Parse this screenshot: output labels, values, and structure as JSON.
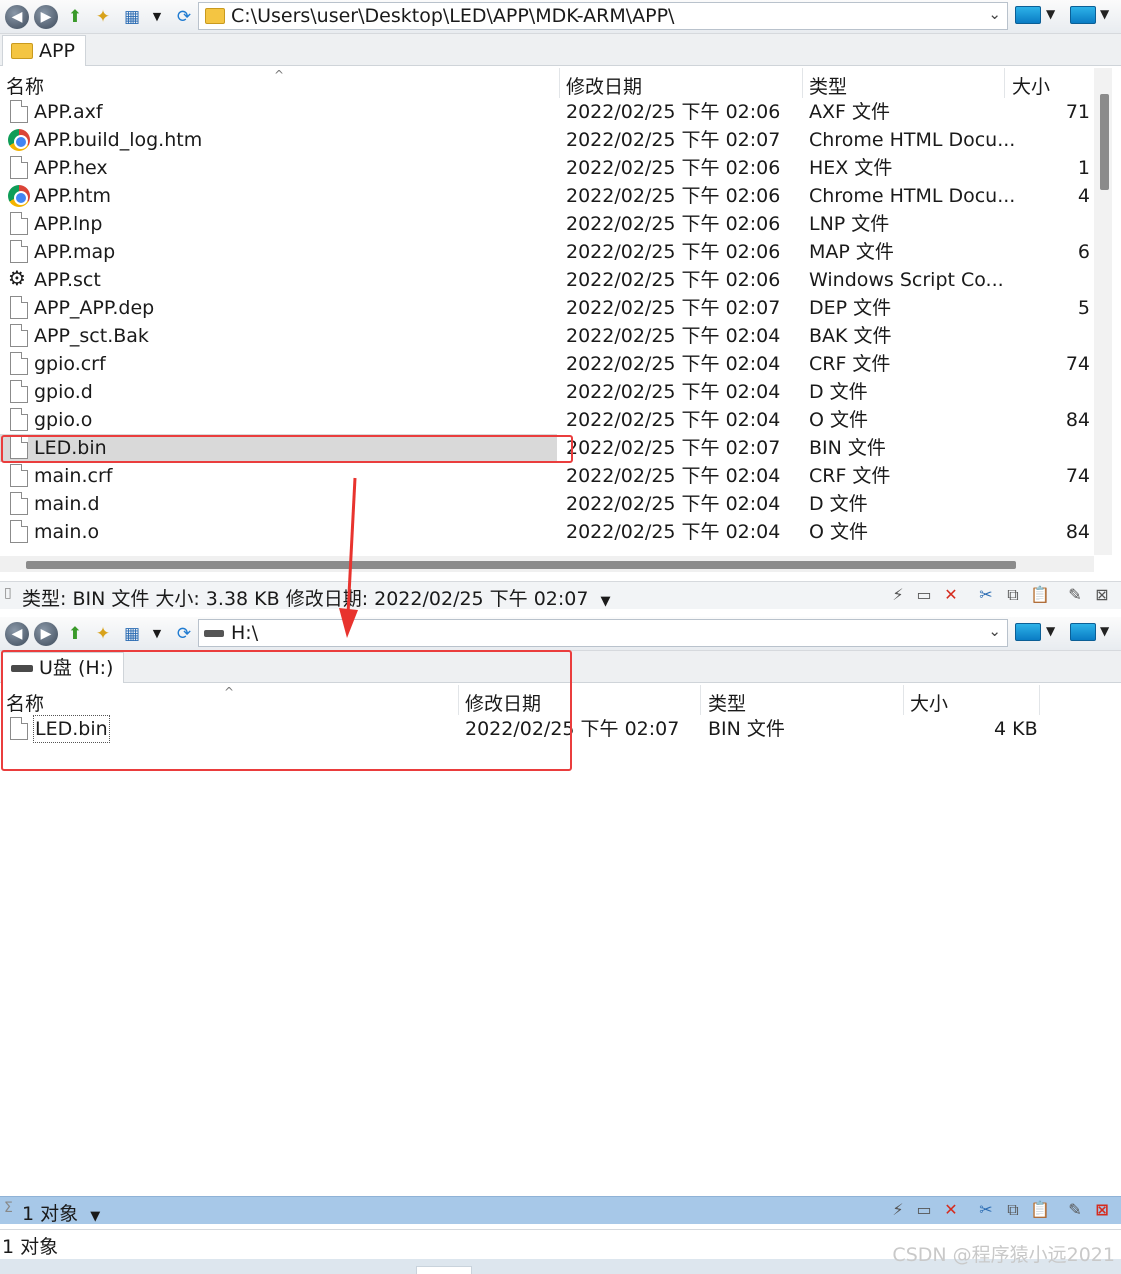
{
  "top_pane": {
    "address": "C:\\Users\\user\\Desktop\\LED\\APP\\MDK-ARM\\APP\\",
    "tab_label": "APP",
    "columns": [
      "名称",
      "修改日期",
      "类型",
      "大小"
    ],
    "files": [
      {
        "name": "APP.axf",
        "date": "2022/02/25 下午 02:06",
        "type": "AXF 文件",
        "size": "71",
        "icon": "file-icon"
      },
      {
        "name": "APP.build_log.htm",
        "date": "2022/02/25 下午 02:07",
        "type": "Chrome HTML Docu...",
        "size": "",
        "icon": "chrome-icon"
      },
      {
        "name": "APP.hex",
        "date": "2022/02/25 下午 02:06",
        "type": "HEX 文件",
        "size": "1",
        "icon": "file-icon"
      },
      {
        "name": "APP.htm",
        "date": "2022/02/25 下午 02:06",
        "type": "Chrome HTML Docu...",
        "size": "4",
        "icon": "chrome-icon"
      },
      {
        "name": "APP.lnp",
        "date": "2022/02/25 下午 02:06",
        "type": "LNP 文件",
        "size": "",
        "icon": "file-icon"
      },
      {
        "name": "APP.map",
        "date": "2022/02/25 下午 02:06",
        "type": "MAP 文件",
        "size": "6",
        "icon": "file-icon"
      },
      {
        "name": "APP.sct",
        "date": "2022/02/25 下午 02:06",
        "type": "Windows Script Co...",
        "size": "",
        "icon": "script-icon"
      },
      {
        "name": "APP_APP.dep",
        "date": "2022/02/25 下午 02:07",
        "type": "DEP 文件",
        "size": "5",
        "icon": "file-icon"
      },
      {
        "name": "APP_sct.Bak",
        "date": "2022/02/25 下午 02:04",
        "type": "BAK 文件",
        "size": "",
        "icon": "file-icon"
      },
      {
        "name": "gpio.crf",
        "date": "2022/02/25 下午 02:04",
        "type": "CRF 文件",
        "size": "74",
        "icon": "file-icon"
      },
      {
        "name": "gpio.d",
        "date": "2022/02/25 下午 02:04",
        "type": "D 文件",
        "size": "",
        "icon": "file-icon"
      },
      {
        "name": "gpio.o",
        "date": "2022/02/25 下午 02:04",
        "type": "O 文件",
        "size": "84",
        "icon": "file-icon"
      },
      {
        "name": "LED.bin",
        "date": "2022/02/25 下午 02:07",
        "type": "BIN 文件",
        "size": "",
        "icon": "file-icon",
        "selected": true
      },
      {
        "name": "main.crf",
        "date": "2022/02/25 下午 02:04",
        "type": "CRF 文件",
        "size": "74",
        "icon": "file-icon"
      },
      {
        "name": "main.d",
        "date": "2022/02/25 下午 02:04",
        "type": "D 文件",
        "size": "",
        "icon": "file-icon"
      },
      {
        "name": "main.o",
        "date": "2022/02/25 下午 02:04",
        "type": "O 文件",
        "size": "84",
        "icon": "file-icon"
      }
    ],
    "status": "类型: BIN 文件 大小: 3.38 KB 修改日期: 2022/02/25 下午 02:07"
  },
  "bottom_pane": {
    "address": "H:\\",
    "tab_label": "U盘 (H:)",
    "columns": [
      "名称",
      "修改日期",
      "类型",
      "大小"
    ],
    "files": [
      {
        "name": "LED.bin",
        "date": "2022/02/25 下午 02:07",
        "type": "BIN 文件",
        "size": "4 KB",
        "icon": "file-icon"
      }
    ],
    "status": "1 对象",
    "bottom_status": "1 对象"
  },
  "watermark": "CSDN @程序猿小远2021",
  "colors": {
    "highlight_box": "#ea3d3d",
    "selected_row": "#d9d9d9",
    "status_blue": "#a7c8e8"
  }
}
